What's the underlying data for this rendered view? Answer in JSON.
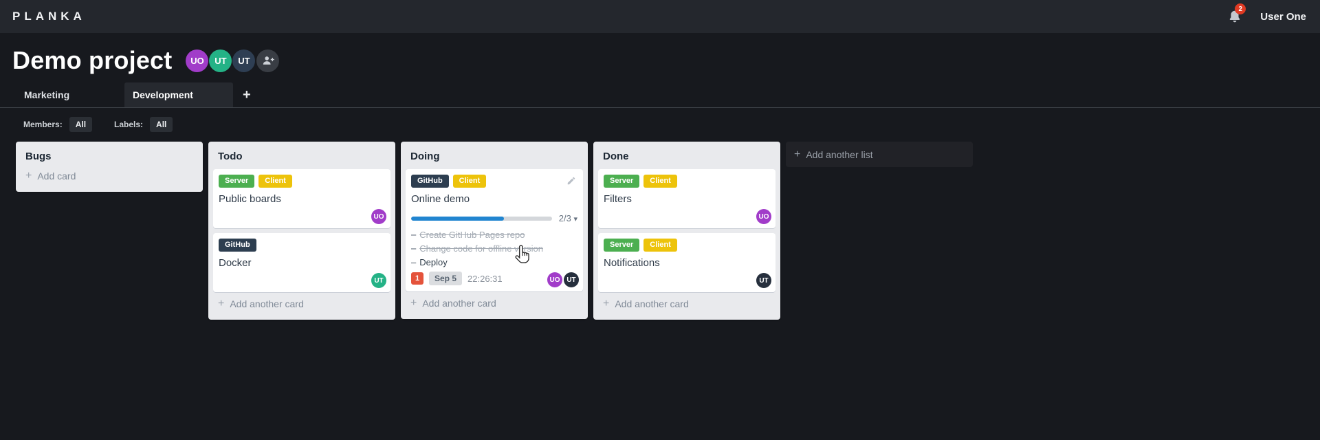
{
  "topbar": {
    "logo": "PLANKA",
    "user_name": "User One",
    "notifications_count": "2"
  },
  "project": {
    "title": "Demo project",
    "members": [
      {
        "initials": "UO",
        "color": "#a13cc9"
      },
      {
        "initials": "UT",
        "color": "#24b286"
      },
      {
        "initials": "UT",
        "color": "#2e3e53"
      }
    ]
  },
  "tabs": {
    "items": [
      {
        "label": "Marketing",
        "active": false
      },
      {
        "label": "Development",
        "active": true
      }
    ],
    "add_label": "+"
  },
  "filters": {
    "members_label": "Members:",
    "members_value": "All",
    "labels_label": "Labels:",
    "labels_value": "All"
  },
  "label_colors": {
    "Server": "#4caf50",
    "Client": "#edc30b",
    "GitHub": "#2d3e50"
  },
  "board": {
    "add_list_label": "Add another list",
    "lists": [
      {
        "title": "Bugs",
        "add_label": "Add card",
        "cards": []
      },
      {
        "title": "Todo",
        "add_label": "Add another card",
        "cards": [
          {
            "name": "Public boards",
            "labels": [
              "Server",
              "Client"
            ],
            "members": [
              {
                "initials": "UO",
                "color": "#a13cc9"
              }
            ]
          },
          {
            "name": "Docker",
            "labels": [
              "GitHub"
            ],
            "members": [
              {
                "initials": "UT",
                "color": "#24b286"
              }
            ]
          }
        ]
      },
      {
        "title": "Doing",
        "add_label": "Add another card",
        "cards": [
          {
            "name": "Online demo",
            "labels": [
              "GitHub",
              "Client"
            ],
            "editable": true,
            "progress": {
              "done": 2,
              "total": 3,
              "label": "2/3",
              "percent": 66
            },
            "tasks": [
              {
                "text": "Create GitHub Pages repo",
                "completed": true
              },
              {
                "text": "Change code for offline version",
                "completed": true
              },
              {
                "text": "Deploy",
                "completed": false
              }
            ],
            "notifications": "1",
            "due_date": "Sep 5",
            "timer": "22:26:31",
            "members": [
              {
                "initials": "UO",
                "color": "#a13cc9"
              },
              {
                "initials": "UT",
                "color": "#262f3d"
              }
            ]
          }
        ]
      },
      {
        "title": "Done",
        "add_label": "Add another card",
        "cards": [
          {
            "name": "Filters",
            "labels": [
              "Server",
              "Client"
            ],
            "members": [
              {
                "initials": "UO",
                "color": "#a13cc9"
              }
            ]
          },
          {
            "name": "Notifications",
            "labels": [
              "Server",
              "Client"
            ],
            "members": [
              {
                "initials": "UT",
                "color": "#262f3d"
              }
            ]
          }
        ]
      }
    ]
  }
}
